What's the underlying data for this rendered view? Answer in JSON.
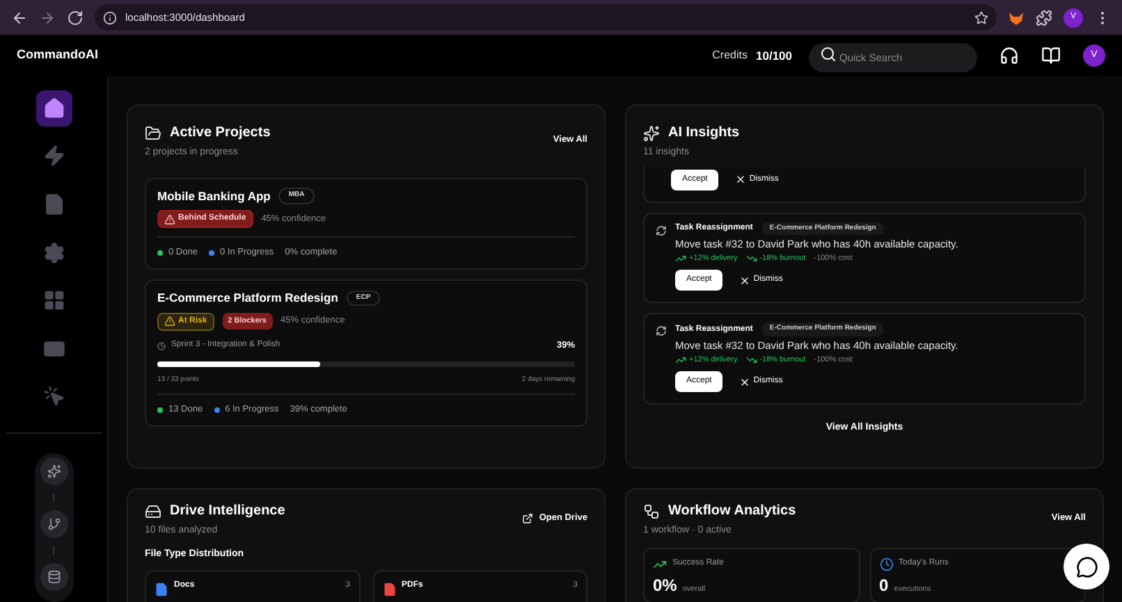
{
  "browser": {
    "url": "localhost:3000/dashboard",
    "profile_initial": "V"
  },
  "header": {
    "brand": "CommandoAI",
    "credits_label": "Credits",
    "credits_value": "10/100",
    "search": {
      "placeholder": "Quick Search"
    },
    "avatar_initial": "V"
  },
  "sidebar": {
    "items": [
      {
        "kind": "home",
        "selected": true
      },
      {
        "kind": "bolt",
        "selected": false
      },
      {
        "kind": "folder",
        "selected": false
      },
      {
        "kind": "gear",
        "selected": false
      },
      {
        "kind": "grid",
        "selected": false
      },
      {
        "kind": "card",
        "selected": false
      },
      {
        "kind": "pointer",
        "selected": false
      }
    ],
    "tools": [
      {
        "kind": "sparkle"
      },
      {
        "kind": "branch"
      },
      {
        "kind": "database"
      }
    ]
  },
  "active_projects": {
    "title": "Active Projects",
    "subtitle": "2 projects in progress",
    "action": "View All",
    "projects": [
      {
        "name": "Mobile Banking App",
        "code": "MBA",
        "status": {
          "label": "Behind Schedule",
          "kind": "danger"
        },
        "confidence": "45% confidence",
        "done": "0 Done",
        "in_progress": "0 In Progress",
        "complete": "0% complete"
      },
      {
        "name": "E-Commerce Platform Redesign",
        "code": "ECP",
        "status": {
          "label": "At Risk",
          "kind": "warning"
        },
        "blockers": "2 Blockers",
        "confidence": "45% confidence",
        "sprint": {
          "name": "Sprint 3 - Integration & Polish",
          "percent": "39%",
          "level": 0.39,
          "points": "13 / 33 points",
          "remaining": "2 days remaining"
        },
        "done": "13 Done",
        "in_progress": "6 In Progress",
        "complete": "39% complete"
      }
    ]
  },
  "ai_insights": {
    "title": "AI Insights",
    "subtitle": "11 insights",
    "insights": [
      {
        "kind": "clipped",
        "accept": "Accept",
        "dismiss": "Dismiss"
      },
      {
        "kind": "full",
        "type": "Task Reassignment",
        "project": "E-Commerce Platform Redesign",
        "text": "Move task #32 to David Park who has 40h available capacity.",
        "impacts": [
          {
            "label": "+12% delivery",
            "kind": "up"
          },
          {
            "label": "-18% burnout",
            "kind": "down"
          },
          {
            "label": "-100% cost",
            "kind": "neutral"
          }
        ],
        "accept": "Accept",
        "dismiss": "Dismiss"
      },
      {
        "kind": "full",
        "type": "Task Reassignment",
        "project": "E-Commerce Platform Redesign",
        "text": "Move task #32 to David Park who has 40h available capacity.",
        "impacts": [
          {
            "label": "+12% delivery",
            "kind": "up"
          },
          {
            "label": "-18% burnout",
            "kind": "down"
          },
          {
            "label": "-100% cost",
            "kind": "neutral"
          }
        ],
        "accept": "Accept",
        "dismiss": "Dismiss"
      }
    ],
    "footer": "View All Insights"
  },
  "drive": {
    "title": "Drive Intelligence",
    "subtitle": "10 files analyzed",
    "action": "Open Drive",
    "section": "File Type Distribution",
    "file_types": [
      {
        "label": "Docs",
        "count": "3",
        "color": "#3b82f6"
      },
      {
        "label": "PDFs",
        "count": "3",
        "color": "#ef4444"
      }
    ]
  },
  "workflow": {
    "title": "Workflow Analytics",
    "subtitle": "1 workflow · 0 active",
    "action": "View All",
    "stats": [
      {
        "kind": "trend",
        "label": "Success Rate",
        "value": "0%",
        "unit": "overall"
      },
      {
        "kind": "clock",
        "label": "Today's Runs",
        "value": "0",
        "unit": "executions"
      }
    ]
  }
}
